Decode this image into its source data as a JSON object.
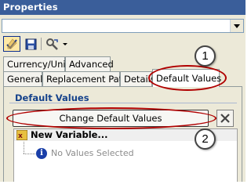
{
  "window": {
    "title": "Properties"
  },
  "toolbar": {
    "items": [
      {
        "icon": "check-edit-icon"
      },
      {
        "icon": "save-icon"
      },
      {
        "icon": "tools-dropdown-icon"
      }
    ]
  },
  "tabs": {
    "row1": [
      {
        "label": "Currency/Unit"
      },
      {
        "label": "Advanced"
      }
    ],
    "row2": [
      {
        "label": "General"
      },
      {
        "label": "Replacement Path"
      },
      {
        "label": "Details"
      },
      {
        "label": "Default Values",
        "selected": true
      }
    ]
  },
  "default_values": {
    "group_label": "Default Values",
    "change_button": "Change Default Values",
    "tree": {
      "root_label": "New Variable...",
      "child_label": "No Values Selected"
    }
  },
  "callouts": [
    "1",
    "2"
  ],
  "colors": {
    "title_bar": "#3a5e9a",
    "annotation_red": "#b00000"
  }
}
